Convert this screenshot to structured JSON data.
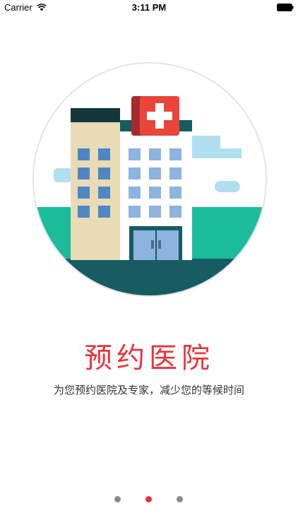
{
  "status_bar": {
    "carrier": "Carrier",
    "time": "3:11 PM"
  },
  "onboarding": {
    "title": "预约医院",
    "subtitle": "为您预约医院及专家，减少您的等候时间",
    "page_count": 3,
    "current_page": 2
  },
  "colors": {
    "accent": "#e8353a",
    "dot_inactive": "#8a8a8a",
    "ground_green": "#1bbc9b",
    "road_teal": "#175b63"
  },
  "icons": {
    "wifi": "wifi-icon",
    "battery": "battery-icon",
    "illustration": "hospital-illustration"
  }
}
